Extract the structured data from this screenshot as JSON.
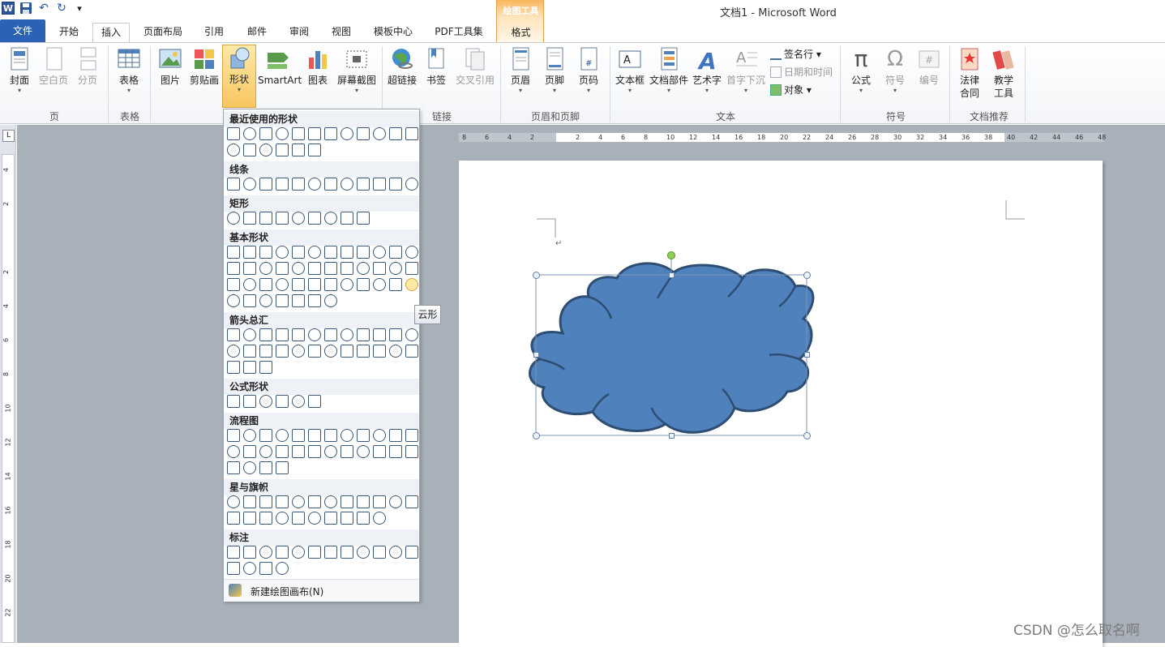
{
  "app": {
    "title": "文档1  -  Microsoft Word",
    "context_tab_group": "绘图工具",
    "context_tab": "格式"
  },
  "qat": {
    "undo_label": "↶",
    "redo_label": "↻",
    "customize_label": "▾"
  },
  "tabs": [
    "文件",
    "开始",
    "插入",
    "页面布局",
    "引用",
    "邮件",
    "审阅",
    "视图",
    "模板中心",
    "PDF工具集"
  ],
  "active_tab": "插入",
  "ribbon": {
    "buttons": [
      {
        "id": "cover",
        "label": "封面",
        "arrow": "▾",
        "enabled": true
      },
      {
        "id": "blank",
        "label": "空白页",
        "enabled": false
      },
      {
        "id": "pagebreak",
        "label": "分页",
        "enabled": false
      },
      {
        "id": "table",
        "label": "表格",
        "arrow": "▾",
        "enabled": true
      },
      {
        "id": "picture",
        "label": "图片",
        "enabled": true
      },
      {
        "id": "clipart",
        "label": "剪贴画",
        "enabled": true
      },
      {
        "id": "shapes",
        "label": "形状",
        "arrow": "▾",
        "enabled": true
      },
      {
        "id": "smartart",
        "label": "SmartArt",
        "enabled": true
      },
      {
        "id": "chart",
        "label": "图表",
        "enabled": true
      },
      {
        "id": "screenshot",
        "label": "屏幕截图",
        "arrow": "▾",
        "enabled": true
      },
      {
        "id": "hyperlink",
        "label": "超链接",
        "enabled": true
      },
      {
        "id": "bookmark",
        "label": "书签",
        "enabled": true
      },
      {
        "id": "crossref",
        "label": "交叉引用",
        "enabled": false
      },
      {
        "id": "header",
        "label": "页眉",
        "arrow": "▾",
        "enabled": true
      },
      {
        "id": "footer",
        "label": "页脚",
        "arrow": "▾",
        "enabled": true
      },
      {
        "id": "pagenum",
        "label": "页码",
        "arrow": "▾",
        "enabled": true
      },
      {
        "id": "textbox",
        "label": "文本框",
        "arrow": "▾",
        "enabled": true
      },
      {
        "id": "quickparts",
        "label": "文档部件",
        "arrow": "▾",
        "enabled": true
      },
      {
        "id": "wordart",
        "label": "艺术字",
        "arrow": "▾",
        "enabled": true
      },
      {
        "id": "dropcap",
        "label": "首字下沉",
        "arrow": "▾",
        "enabled": false
      },
      {
        "id": "equation",
        "label": "公式",
        "arrow": "▾",
        "enabled": true
      },
      {
        "id": "symbol",
        "label": "符号",
        "arrow": "▾",
        "enabled": false
      },
      {
        "id": "number",
        "label": "编号",
        "enabled": false
      },
      {
        "id": "legal",
        "label": "法律\n合同",
        "enabled": true
      },
      {
        "id": "teaching",
        "label": "教学\n工具",
        "enabled": true
      }
    ],
    "small_buttons": {
      "signature": "签名行 ▾",
      "datetime": "日期和时间",
      "object": "对象 ▾"
    },
    "groups": [
      "页",
      "表格",
      "链接",
      "页眉和页脚",
      "文本",
      "符号",
      "文档推荐"
    ]
  },
  "shapes_gallery": {
    "sections": [
      "最近使用的形状",
      "线条",
      "矩形",
      "基本形状",
      "箭头总汇",
      "公式形状",
      "流程图",
      "星与旗帜",
      "标注"
    ],
    "footer": "新建绘图画布(N)",
    "hovered_shape_tooltip": "云形"
  },
  "ruler": {
    "h_ticks": [
      "8",
      "6",
      "4",
      "2",
      "",
      "2",
      "4",
      "6",
      "8",
      "10",
      "12",
      "14",
      "16",
      "18",
      "20",
      "22",
      "24",
      "26",
      "28",
      "30",
      "32",
      "34",
      "36",
      "38",
      "40",
      "42",
      "44",
      "46",
      "48"
    ],
    "v_ticks": [
      "4",
      "2",
      "",
      "2",
      "4",
      "6",
      "8",
      "10",
      "12",
      "14",
      "16",
      "18",
      "20",
      "22"
    ]
  },
  "document": {
    "paragraph_mark": "↵",
    "shape": "cloud",
    "shape_fill": "#4f81bd",
    "shape_stroke": "#2e4d72"
  },
  "watermark": "CSDN @怎么取名啊",
  "colors": {
    "file_tab": "#2a62b8",
    "accent_shape": "#4f81bd",
    "context_tab": "#f7b65a"
  }
}
